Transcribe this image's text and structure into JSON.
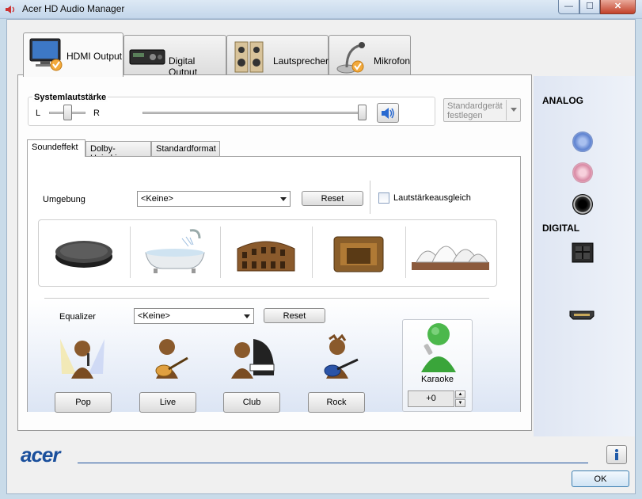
{
  "window": {
    "title": "Acer HD Audio Manager"
  },
  "tabs": [
    {
      "label": "HDMI Output",
      "icon": "monitor-icon"
    },
    {
      "label": "Digital Output",
      "icon": "receiver-icon"
    },
    {
      "label": "Lautsprecher",
      "icon": "speaker-icon"
    },
    {
      "label": "Mikrofon",
      "icon": "microphone-icon"
    }
  ],
  "volume": {
    "title": "Systemlautstärke",
    "left_label": "L",
    "right_label": "R",
    "balance": 0.5,
    "level": 1.0
  },
  "default_device_button": "Standardgerät festlegen",
  "subtabs": [
    "Soundeffekt",
    "Dolby-Heimkino",
    "Standardformat"
  ],
  "environment": {
    "label": "Umgebung",
    "selected": "<Keine>",
    "reset_label": "Reset",
    "loudness_label": "Lautstärkeausgleich",
    "loudness_checked": false
  },
  "equalizer": {
    "label": "Equalizer",
    "selected": "<Keine>",
    "reset_label": "Reset",
    "presets": [
      "Pop",
      "Live",
      "Club",
      "Rock"
    ]
  },
  "karaoke": {
    "label": "Karaoke",
    "value": "+0"
  },
  "connectors": {
    "analog_label": "ANALOG",
    "digital_label": "DIGITAL",
    "analog_colors": [
      "#6f8fd6",
      "#e8a9c0",
      "#1a1a1a"
    ]
  },
  "footer": {
    "brand": "acer",
    "ok_label": "OK",
    "info_icon": "info-icon"
  },
  "colors": {
    "accent": "#1f5aa8",
    "brand": "#1a4f9c",
    "karaoke_green": "#3aa53a"
  }
}
